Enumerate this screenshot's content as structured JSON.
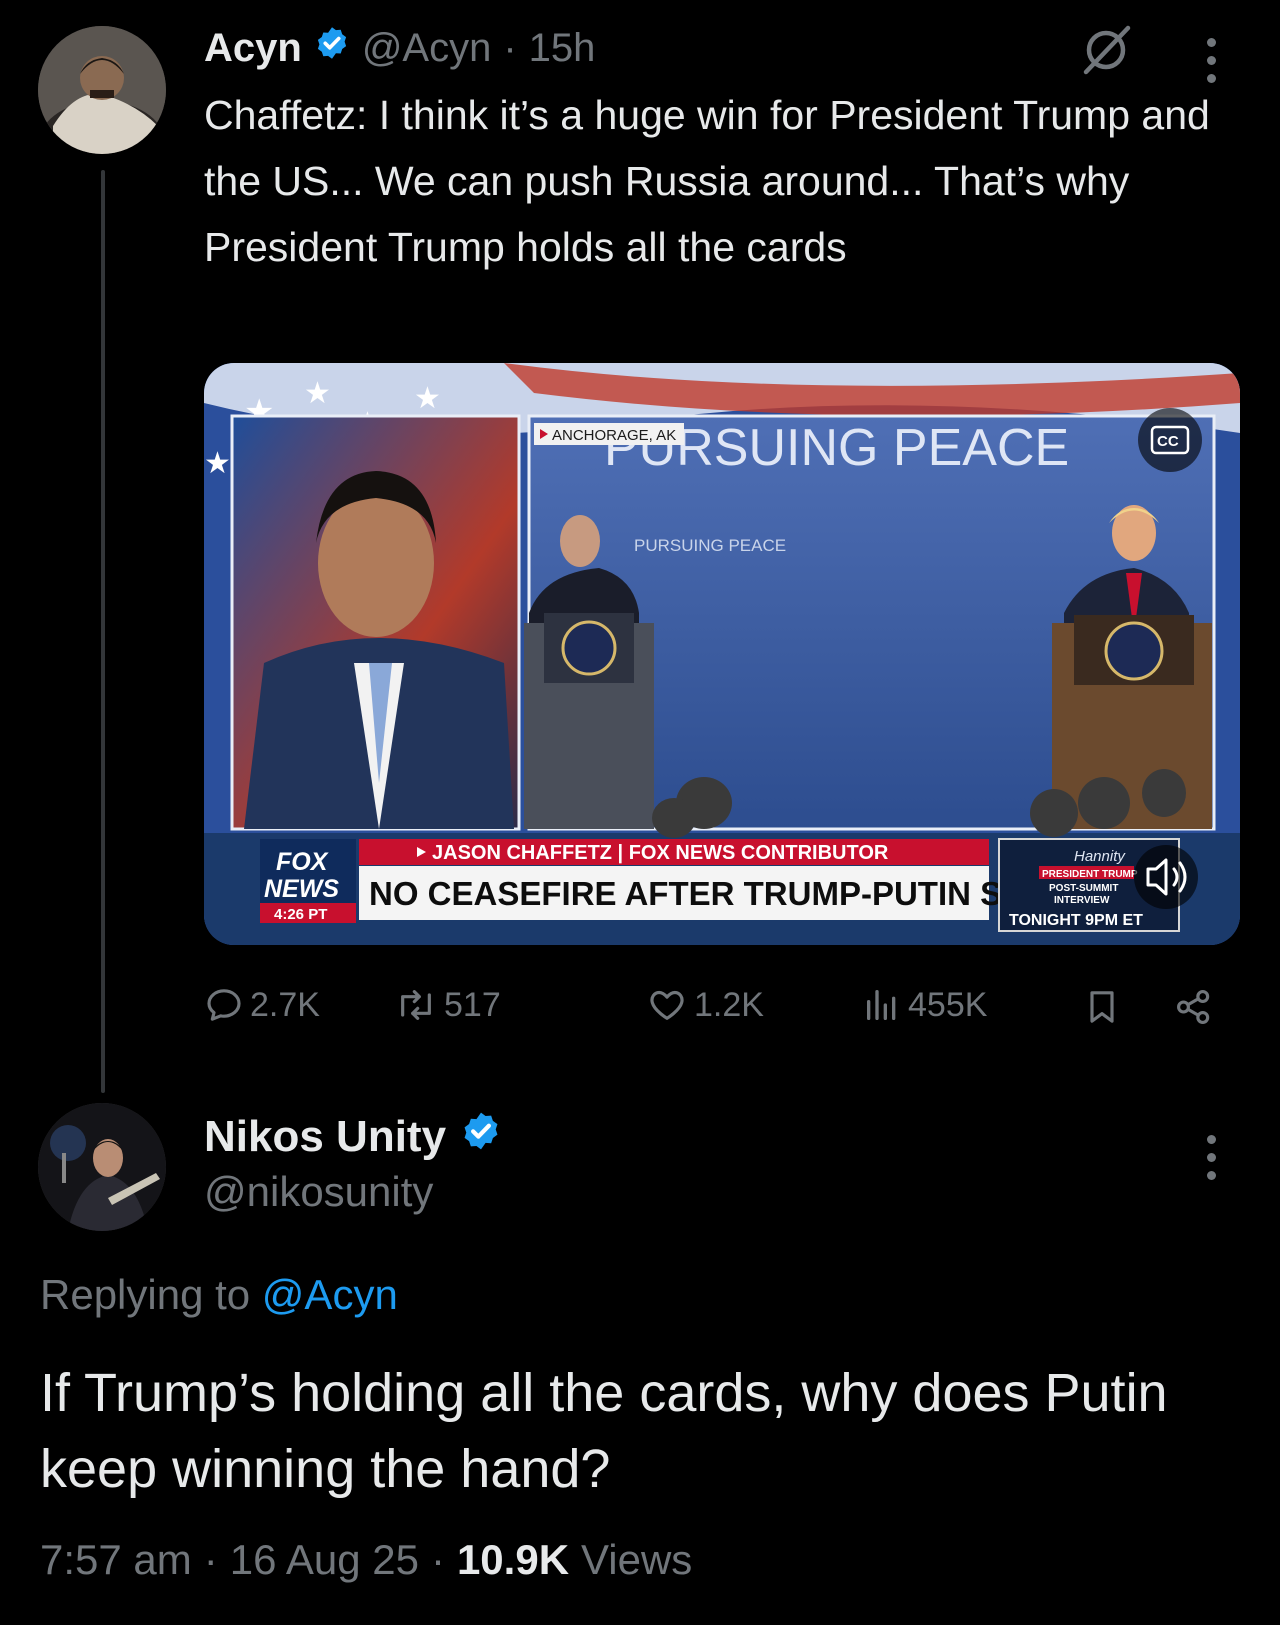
{
  "tweet": {
    "author_name": "Acyn",
    "handle": "@Acyn",
    "separator": "·",
    "time": "15h",
    "text": "Chaffetz: I think it’s a huge win for President Trump and the US... We can push Russia around... That’s why President Trump holds all the cards",
    "media": {
      "location_tag": "ANCHORAGE, AK",
      "backdrop_title": "PURSUING PEACE",
      "podium_sign": "PURSUING PEACE",
      "lower_third_name": "JASON CHAFFETZ | FOX NEWS CONTRIBUTOR",
      "headline": "NO CEASEFIRE AFTER TRUMP-PUTIN SUMMIT",
      "network_line1": "FOX",
      "network_line2": "NEWS",
      "clock": "4:26 PT",
      "promo_show": "Hannity",
      "promo_line1": "PRESIDENT TRUMP",
      "promo_line2": "POST-SUMMIT",
      "promo_line3": "INTERVIEW",
      "promo_time": "TONIGHT 9PM ET",
      "cc_label": "CC"
    },
    "metrics": {
      "replies": "2.7K",
      "reposts": "517",
      "likes": "1.2K",
      "views": "455K"
    }
  },
  "reply": {
    "author_name": "Nikos Unity",
    "handle": "@nikosunity",
    "replying_prefix": "Replying to",
    "replying_handle": "@Acyn",
    "text": "If Trump’s holding all the cards, why does Putin keep winning the hand?",
    "time": "7:57 am",
    "date": "16 Aug 25",
    "views_count": "10.9K",
    "views_label": "Views",
    "separator": "·"
  },
  "colors": {
    "background": "#000000",
    "text": "#e7e9ea",
    "muted": "#71767b",
    "accent": "#1d9bf0",
    "fox_red": "#c8102e"
  },
  "icons": [
    "verified-badge-icon",
    "grok-icon",
    "more-icon",
    "reply-icon",
    "repost-icon",
    "like-icon",
    "views-icon",
    "bookmark-icon",
    "share-icon",
    "cc-icon",
    "volume-icon"
  ]
}
